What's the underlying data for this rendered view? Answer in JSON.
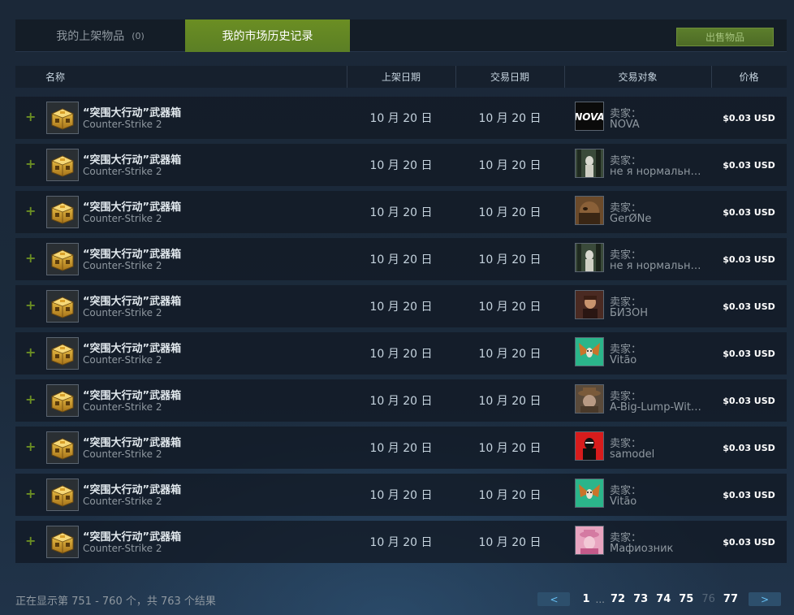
{
  "tabs": {
    "listings_label": "我的上架物品",
    "listings_count": "(0)",
    "history_label": "我的市场历史记录"
  },
  "sell_button": "出售物品",
  "table_headers": {
    "name": "名称",
    "listed_on": "上架日期",
    "acted_on": "交易日期",
    "who": "交易对象",
    "price": "价格"
  },
  "rows": [
    {
      "item_name": "“突围大行动”武器箱",
      "game": "Counter-Strike 2",
      "listed": "10 月 20 日",
      "acted": "10 月 20 日",
      "who_label": "卖家：",
      "who_name": "NOVA",
      "avatar": "nova-avatar",
      "price": "$0.03 USD"
    },
    {
      "item_name": "“突围大行动”武器箱",
      "game": "Counter-Strike 2",
      "listed": "10 月 20 日",
      "acted": "10 月 20 日",
      "who_label": "卖家：",
      "who_name": "не я нормальный",
      "avatar": "forest-avatar",
      "price": "$0.03 USD"
    },
    {
      "item_name": "“突围大行动”武器箱",
      "game": "Counter-Strike 2",
      "listed": "10 月 20 日",
      "acted": "10 月 20 日",
      "who_label": "卖家：",
      "who_name": "ĜerØNe",
      "avatar": "brown-avatar",
      "price": "$0.03 USD"
    },
    {
      "item_name": "“突围大行动”武器箱",
      "game": "Counter-Strike 2",
      "listed": "10 月 20 日",
      "acted": "10 月 20 日",
      "who_label": "卖家：",
      "who_name": "не я нормальный",
      "avatar": "forest-avatar",
      "price": "$0.03 USD"
    },
    {
      "item_name": "“突围大行动”武器箱",
      "game": "Counter-Strike 2",
      "listed": "10 月 20 日",
      "acted": "10 月 20 日",
      "who_label": "卖家：",
      "who_name": "БИЗОН",
      "avatar": "portrait-avatar",
      "price": "$0.03 USD"
    },
    {
      "item_name": "“突围大行动”武器箱",
      "game": "Counter-Strike 2",
      "listed": "10 月 20 日",
      "acted": "10 月 20 日",
      "who_label": "卖家：",
      "who_name": "Vitão",
      "avatar": "butterfly-avatar",
      "price": "$0.03 USD"
    },
    {
      "item_name": "“突围大行动”武器箱",
      "game": "Counter-Strike 2",
      "listed": "10 月 20 日",
      "acted": "10 月 20 日",
      "who_label": "卖家：",
      "who_name": "A-Big-Lump-Wit…",
      "avatar": "hat-avatar",
      "price": "$0.03 USD"
    },
    {
      "item_name": "“突围大行动”武器箱",
      "game": "Counter-Strike 2",
      "listed": "10 月 20 日",
      "acted": "10 月 20 日",
      "who_label": "卖家：",
      "who_name": "samodel",
      "avatar": "red-avatar",
      "price": "$0.03 USD"
    },
    {
      "item_name": "“突围大行动”武器箱",
      "game": "Counter-Strike 2",
      "listed": "10 月 20 日",
      "acted": "10 月 20 日",
      "who_label": "卖家：",
      "who_name": "Vitão",
      "avatar": "butterfly-avatar",
      "price": "$0.03 USD"
    },
    {
      "item_name": "“突围大行动”武器箱",
      "game": "Counter-Strike 2",
      "listed": "10 月 20 日",
      "acted": "10 月 20 日",
      "who_label": "卖家：",
      "who_name": "Мафиозник",
      "avatar": "pink-avatar",
      "price": "$0.03 USD"
    }
  ],
  "summary": "正在显示第 751 - 760 个，共 763 个结果",
  "pagination": {
    "prev": "<",
    "next": ">",
    "first": "1",
    "ellipsis": "...",
    "pages": [
      "72",
      "73",
      "74",
      "75",
      "76",
      "77"
    ],
    "current": "76"
  }
}
